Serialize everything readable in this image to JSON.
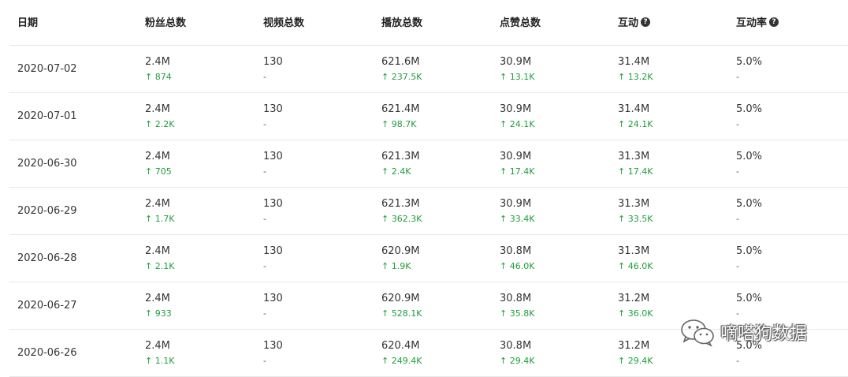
{
  "headers": {
    "date": "日期",
    "fans": "粉丝总数",
    "videos": "视频总数",
    "plays": "播放总数",
    "likes": "点赞总数",
    "interaction": "互动",
    "interaction_rate": "互动率",
    "help_glyph": "?"
  },
  "rows": [
    {
      "date": "2020-07-02",
      "fans": "2.4M",
      "fans_d": "↑ 874",
      "videos": "130",
      "videos_d": "-",
      "plays": "621.6M",
      "plays_d": "↑ 237.5K",
      "likes": "30.9M",
      "likes_d": "↑ 13.1K",
      "inter": "31.4M",
      "inter_d": "↑ 13.2K",
      "rate": "5.0%",
      "rate_d": "-"
    },
    {
      "date": "2020-07-01",
      "fans": "2.4M",
      "fans_d": "↑ 2.2K",
      "videos": "130",
      "videos_d": "-",
      "plays": "621.4M",
      "plays_d": "↑ 98.7K",
      "likes": "30.9M",
      "likes_d": "↑ 24.1K",
      "inter": "31.4M",
      "inter_d": "↑ 24.1K",
      "rate": "5.0%",
      "rate_d": "-"
    },
    {
      "date": "2020-06-30",
      "fans": "2.4M",
      "fans_d": "↑ 705",
      "videos": "130",
      "videos_d": "-",
      "plays": "621.3M",
      "plays_d": "↑ 2.4K",
      "likes": "30.9M",
      "likes_d": "↑ 17.4K",
      "inter": "31.3M",
      "inter_d": "↑ 17.4K",
      "rate": "5.0%",
      "rate_d": "-"
    },
    {
      "date": "2020-06-29",
      "fans": "2.4M",
      "fans_d": "↑ 1.7K",
      "videos": "130",
      "videos_d": "-",
      "plays": "621.3M",
      "plays_d": "↑ 362.3K",
      "likes": "30.9M",
      "likes_d": "↑ 33.4K",
      "inter": "31.3M",
      "inter_d": "↑ 33.5K",
      "rate": "5.0%",
      "rate_d": "-"
    },
    {
      "date": "2020-06-28",
      "fans": "2.4M",
      "fans_d": "↑ 2.1K",
      "videos": "130",
      "videos_d": "-",
      "plays": "620.9M",
      "plays_d": "↑ 1.9K",
      "likes": "30.8M",
      "likes_d": "↑ 46.0K",
      "inter": "31.3M",
      "inter_d": "↑ 46.0K",
      "rate": "5.0%",
      "rate_d": "-"
    },
    {
      "date": "2020-06-27",
      "fans": "2.4M",
      "fans_d": "↑ 933",
      "videos": "130",
      "videos_d": "-",
      "plays": "620.9M",
      "plays_d": "↑ 528.1K",
      "likes": "30.8M",
      "likes_d": "↑ 35.8K",
      "inter": "31.2M",
      "inter_d": "↑ 36.0K",
      "rate": "5.0%",
      "rate_d": "-"
    },
    {
      "date": "2020-06-26",
      "fans": "2.4M",
      "fans_d": "↑ 1.1K",
      "videos": "130",
      "videos_d": "-",
      "plays": "620.4M",
      "plays_d": "↑ 249.4K",
      "likes": "30.8M",
      "likes_d": "↑ 29.4K",
      "inter": "31.2M",
      "inter_d": "↑ 29.4K",
      "rate": "5.0%",
      "rate_d": "-"
    }
  ],
  "watermark": {
    "text": "嘀嗒狗数据",
    "icon": "wechat-icon"
  },
  "colors": {
    "increase": "#1e9e3c",
    "border": "#e8e8e8",
    "text": "#333333"
  }
}
